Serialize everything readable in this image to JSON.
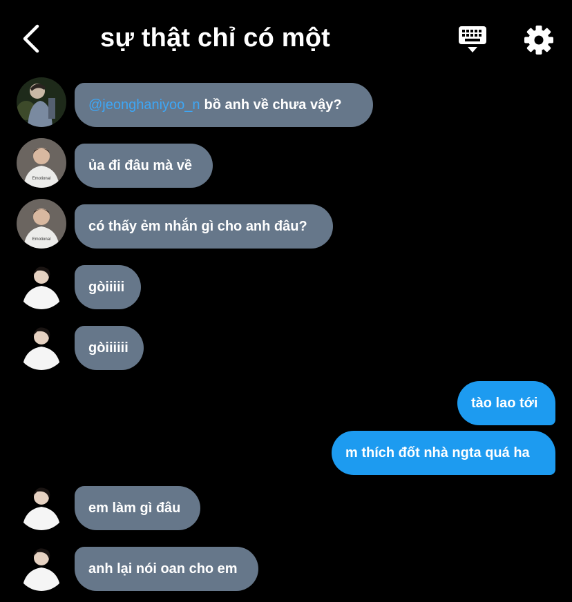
{
  "header": {
    "title": "sự thật chỉ có một",
    "back_icon": "chevron-left-icon",
    "keyboard_icon": "keyboard-icon",
    "settings_icon": "gear-icon"
  },
  "colors": {
    "background": "#000000",
    "incoming_bubble": "#66778a",
    "outgoing_bubble": "#1d9bf0",
    "mention": "#3ea6f5"
  },
  "messages": [
    {
      "side": "in",
      "mention": "@jeonghaniyoo_n",
      "text": "bồ anh về chưa vậy?",
      "avatar": "avatar-man-night"
    },
    {
      "side": "in",
      "text": "ủa đi đâu mà về",
      "avatar": "avatar-man-tshirt"
    },
    {
      "side": "in",
      "text": "có thấy ẻm nhắn gì cho anh đâu?",
      "avatar": "avatar-man-tshirt"
    },
    {
      "side": "in",
      "text": "gòiiiii",
      "avatar": "avatar-man-white"
    },
    {
      "side": "in",
      "text": "gòiiiiii",
      "avatar": "avatar-man-white"
    },
    {
      "side": "out",
      "text": "tào lao tới"
    },
    {
      "side": "out",
      "text": "m thích đốt nhà ngta quá ha"
    },
    {
      "side": "in",
      "text": "em làm gì đâu",
      "avatar": "avatar-man-white"
    },
    {
      "side": "in",
      "text": "anh lại nói oan cho em",
      "avatar": "avatar-man-white"
    }
  ]
}
